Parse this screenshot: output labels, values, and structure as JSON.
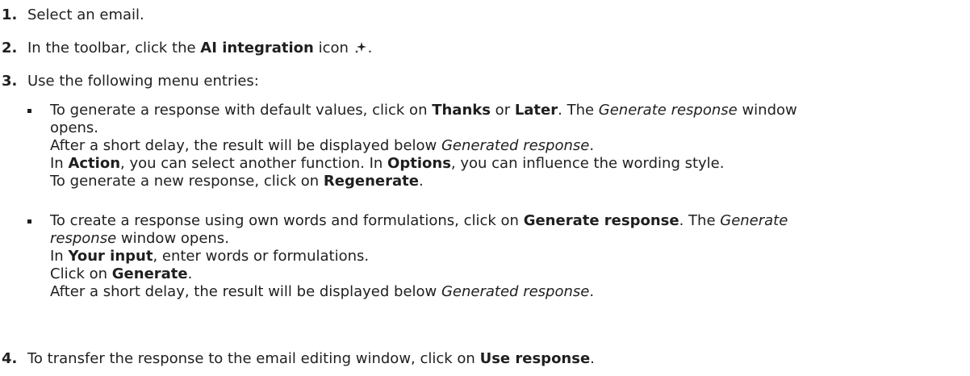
{
  "steps": [
    {
      "number": "1.",
      "text": "Select an email."
    },
    {
      "number": "2.",
      "pre": "In the toolbar, click the ",
      "bold": "AI integration",
      "post": " icon ",
      "icon": "ai-sparkle-icon",
      "end": "."
    },
    {
      "number": "3.",
      "text": "Use the following menu entries:"
    },
    {
      "number": "4.",
      "pre": "To transfer the response to the email editing window, click on ",
      "bold": "Use response",
      "end": "."
    }
  ],
  "bullet1": {
    "l1_a": "To generate a response with default values, click on ",
    "l1_b": "Thanks",
    "l1_c": " or ",
    "l1_d": "Later",
    "l1_e": ". The ",
    "l1_f": "Generate response",
    "l1_g": " window",
    "l2": "opens.",
    "l3_a": "After a short delay, the result will be displayed below ",
    "l3_b": "Generated response",
    "l3_c": ".",
    "l4_a": "In ",
    "l4_b": "Action",
    "l4_c": ", you can select another function. In ",
    "l4_d": "Options",
    "l4_e": ", you can influence the wording style.",
    "l5_a": "To generate a new response, click on ",
    "l5_b": "Regenerate",
    "l5_c": "."
  },
  "bullet2": {
    "l1_a": "To create a response using own words and formulations, click on ",
    "l1_b": "Generate response",
    "l1_c": ". The ",
    "l1_d": "Generate",
    "l2_a": "response",
    "l2_b": " window opens.",
    "l3_a": "In ",
    "l3_b": "Your input",
    "l3_c": ", enter words or formulations.",
    "l4_a": "Click on ",
    "l4_b": "Generate",
    "l4_c": ".",
    "l5_a": "After a short delay, the result will be displayed below ",
    "l5_b": "Generated response",
    "l5_c": "."
  }
}
